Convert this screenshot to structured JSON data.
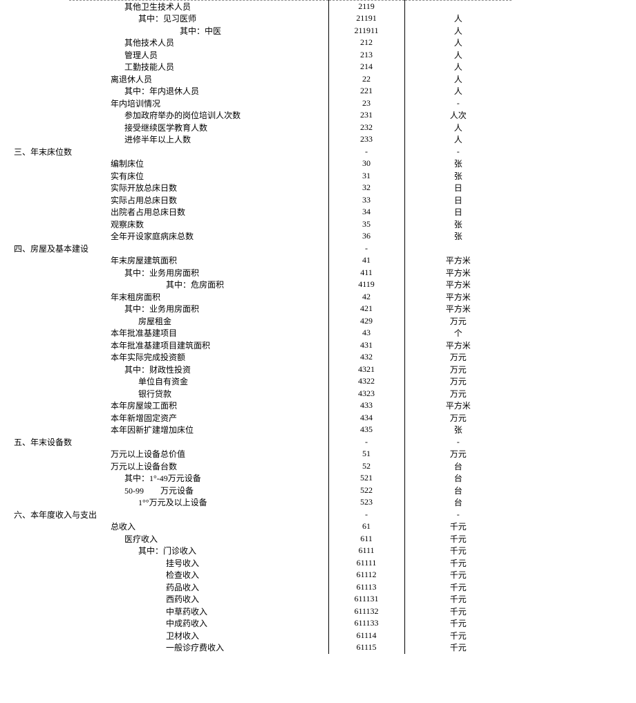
{
  "rows": [
    {
      "name": "其他卫生技术人员",
      "code": "2119",
      "unit": "",
      "cls": "i1",
      "top": true
    },
    {
      "name": "其中：见习医师",
      "code": "21191",
      "unit": "人",
      "cls": "i2"
    },
    {
      "name": "其中：中医",
      "code": "211911",
      "unit": "人",
      "cls": "i4"
    },
    {
      "name": "其他技术人员",
      "code": "212",
      "unit": "人",
      "cls": "i1"
    },
    {
      "name": "管理人员",
      "code": "213",
      "unit": "人",
      "cls": "i1"
    },
    {
      "name": "工勤技能人员",
      "code": "214",
      "unit": "人",
      "cls": "i1"
    },
    {
      "name": "离退休人员",
      "code": "22",
      "unit": "人",
      "cls": "i0"
    },
    {
      "name": "其中：年内退休人员",
      "code": "221",
      "unit": "人",
      "cls": "i1"
    },
    {
      "name": "年内培训情况",
      "code": "23",
      "unit": "-",
      "cls": "i0"
    },
    {
      "name": "参加政府举办的岗位培训人次数",
      "code": "231",
      "unit": "人次",
      "cls": "i1"
    },
    {
      "name": "接受继续医学教育人数",
      "code": "232",
      "unit": "人",
      "cls": "i1"
    },
    {
      "name": "进修半年以上人数",
      "code": "233",
      "unit": "人",
      "cls": "i1"
    },
    {
      "name": "三、年末床位数",
      "code": "-",
      "unit": "-",
      "cls": "sec"
    },
    {
      "name": "编制床位",
      "code": "30",
      "unit": "张",
      "cls": "i0"
    },
    {
      "name": "实有床位",
      "code": "31",
      "unit": "张",
      "cls": "i0"
    },
    {
      "name": "实际开放总床日数",
      "code": "32",
      "unit": "日",
      "cls": "i0"
    },
    {
      "name": "实际占用总床日数",
      "code": "33",
      "unit": "日",
      "cls": "i0"
    },
    {
      "name": "出院者占用总床日数",
      "code": "34",
      "unit": "日",
      "cls": "i0"
    },
    {
      "name": "观察床数",
      "code": "35",
      "unit": "张",
      "cls": "i0"
    },
    {
      "name": "全年开设家庭病床总数",
      "code": "36",
      "unit": "张",
      "cls": "i0"
    },
    {
      "name": "四、房屋及基本建设",
      "code": "-",
      "unit": "",
      "cls": "sec"
    },
    {
      "name": "年末房屋建筑面积",
      "code": "41",
      "unit": "平方米",
      "cls": "i0"
    },
    {
      "name": "其中：业务用房面积",
      "code": "411",
      "unit": "平方米",
      "cls": "i1"
    },
    {
      "name": "其中：危房面积",
      "code": "4119",
      "unit": "平方米",
      "cls": "i3"
    },
    {
      "name": "年末租房面积",
      "code": "42",
      "unit": "平方米",
      "cls": "i0"
    },
    {
      "name": "其中：业务用房面积",
      "code": "421",
      "unit": "平方米",
      "cls": "i1"
    },
    {
      "name": "房屋租金",
      "code": "429",
      "unit": "万元",
      "cls": "i2"
    },
    {
      "name": "本年批准基建项目",
      "code": "43",
      "unit": "个",
      "cls": "i0"
    },
    {
      "name": "本年批准基建项目建筑面积",
      "code": "431",
      "unit": "平方米",
      "cls": "i0"
    },
    {
      "name": "本年实际完成投资额",
      "code": "432",
      "unit": "万元",
      "cls": "i0"
    },
    {
      "name": "其中：财政性投资",
      "code": "4321",
      "unit": "万元",
      "cls": "i1"
    },
    {
      "name": "单位自有资金",
      "code": "4322",
      "unit": "万元",
      "cls": "i2"
    },
    {
      "name": "银行贷款",
      "code": "4323",
      "unit": "万元",
      "cls": "i2"
    },
    {
      "name": "本年房屋竣工面积",
      "code": "433",
      "unit": "平方米",
      "cls": "i0"
    },
    {
      "name": "本年新增固定资产",
      "code": "434",
      "unit": "万元",
      "cls": "i0"
    },
    {
      "name": "本年因新扩建增加床位",
      "code": "435",
      "unit": "张",
      "cls": "i0"
    },
    {
      "name": "五、年末设备数",
      "code": "-",
      "unit": "-",
      "cls": "sec"
    },
    {
      "name": "万元以上设备总价值",
      "code": "51",
      "unit": "万元",
      "cls": "i0"
    },
    {
      "name": "万元以上设备台数",
      "code": "52",
      "unit": "台",
      "cls": "i0"
    },
    {
      "name": "其中：1°-49万元设备",
      "code": "521",
      "unit": "台",
      "cls": "i1"
    },
    {
      "name": "50-99　　万元设备",
      "code": "522",
      "unit": "台",
      "cls": "i1"
    },
    {
      "name": "1°°万元及以上设备",
      "code": "523",
      "unit": "台",
      "cls": "i2"
    },
    {
      "name": "六、本年度收入与支出",
      "code": "-",
      "unit": "-",
      "cls": "sec"
    },
    {
      "name": "总收入",
      "code": "61",
      "unit": "千元",
      "cls": "i0"
    },
    {
      "name": "医疗收入",
      "code": "611",
      "unit": "千元",
      "cls": "i1"
    },
    {
      "name": "其中：门诊收入",
      "code": "6111",
      "unit": "千元",
      "cls": "i2"
    },
    {
      "name": "挂号收入",
      "code": "61111",
      "unit": "千元",
      "cls": "i3"
    },
    {
      "name": "检查收入",
      "code": "61112",
      "unit": "千元",
      "cls": "i3"
    },
    {
      "name": "药品收入",
      "code": "61113",
      "unit": "千元",
      "cls": "i3"
    },
    {
      "name": "西药收入",
      "code": "611131",
      "unit": "千元",
      "cls": "i3"
    },
    {
      "name": "中草药收入",
      "code": "611132",
      "unit": "千元",
      "cls": "i3"
    },
    {
      "name": "中成药收入",
      "code": "611133",
      "unit": "千元",
      "cls": "i3"
    },
    {
      "name": "卫材收入",
      "code": "61114",
      "unit": "千元",
      "cls": "i3"
    },
    {
      "name": "一般诊疗费收入",
      "code": "61115",
      "unit": "千元",
      "cls": "i3"
    }
  ]
}
